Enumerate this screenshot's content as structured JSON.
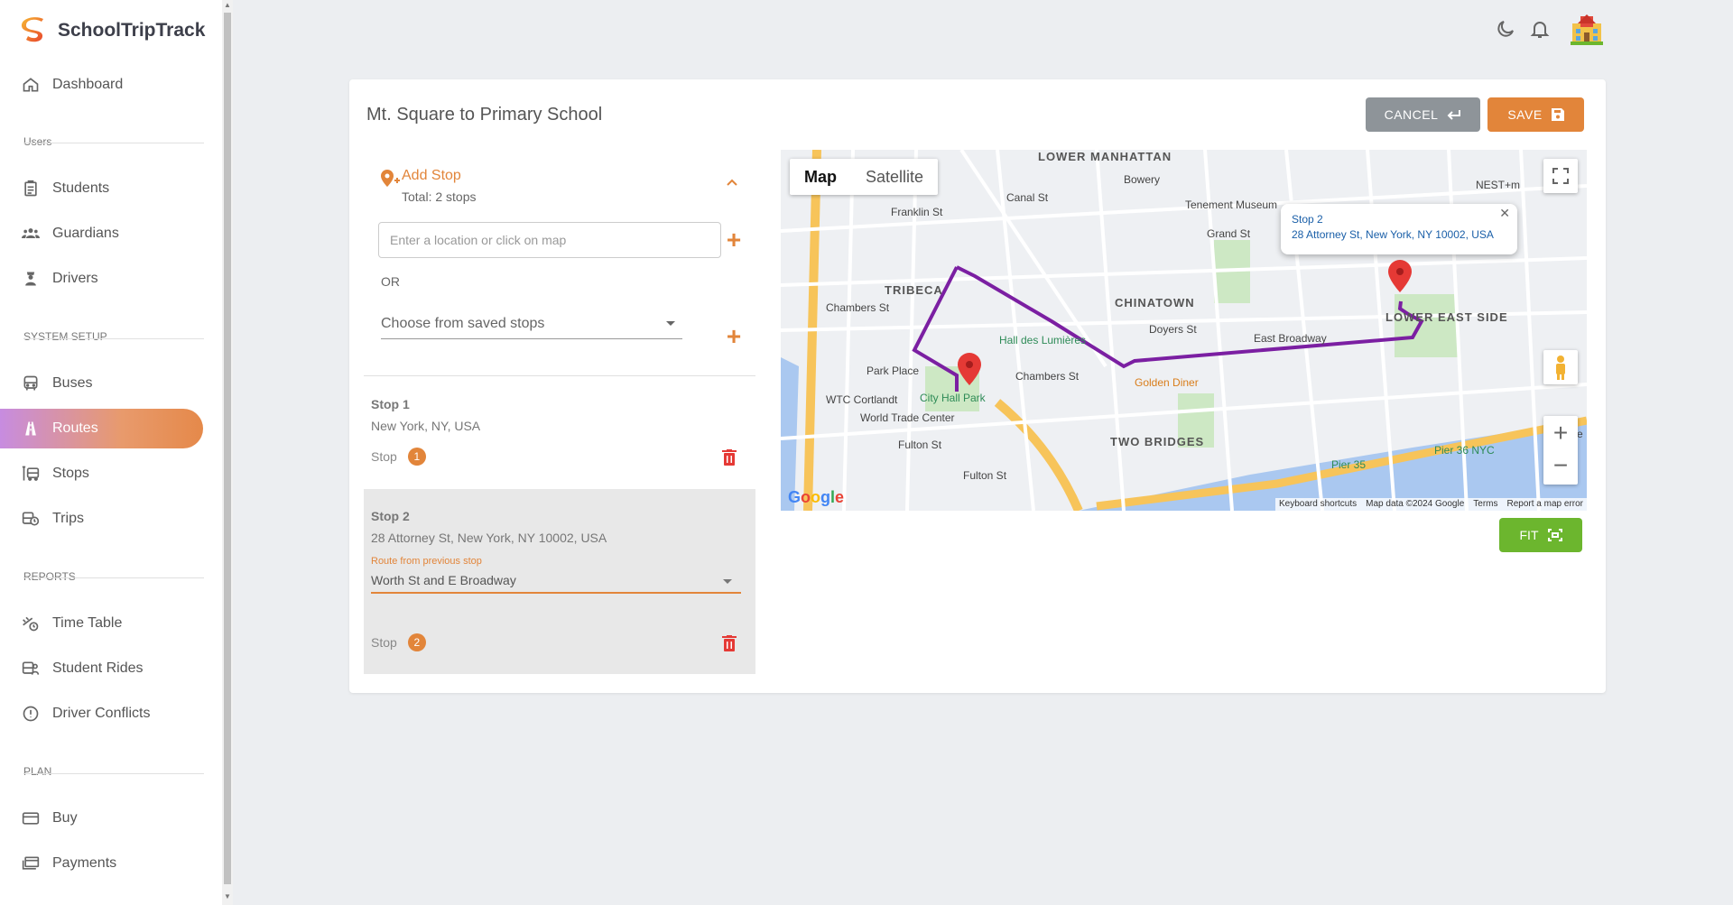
{
  "app": {
    "name": "SchoolTripTrack"
  },
  "sidebar": {
    "items": [
      {
        "label": "Dashboard",
        "icon": "home-icon"
      },
      {
        "label": "Students",
        "icon": "clipboard-icon"
      },
      {
        "label": "Guardians",
        "icon": "group-icon"
      },
      {
        "label": "Drivers",
        "icon": "driver-icon"
      },
      {
        "label": "Buses",
        "icon": "bus-icon"
      },
      {
        "label": "Routes",
        "icon": "road-icon"
      },
      {
        "label": "Stops",
        "icon": "bus-stop-icon"
      },
      {
        "label": "Trips",
        "icon": "bus-clock-icon"
      },
      {
        "label": "Time Table",
        "icon": "timetable-icon"
      },
      {
        "label": "Student Rides",
        "icon": "ride-icon"
      },
      {
        "label": "Driver Conflicts",
        "icon": "alert-circle-icon"
      },
      {
        "label": "Buy",
        "icon": "card-icon"
      },
      {
        "label": "Payments",
        "icon": "payments-icon"
      }
    ],
    "sections": {
      "users": "Users",
      "setup": "SYSTEM SETUP",
      "reports": "REPORTS",
      "plan": "PLAN"
    },
    "active": "Routes"
  },
  "page": {
    "title": "Mt. Square to Primary School",
    "cancel_label": "CANCEL",
    "save_label": "SAVE",
    "fit_label": "FIT"
  },
  "add_stop": {
    "title": "Add Stop",
    "total": "Total: 2 stops",
    "location_placeholder": "Enter a location or click on map",
    "or_text": "OR",
    "saved_stops_label": "Choose from saved stops"
  },
  "stops": [
    {
      "title": "Stop 1",
      "address": "New York, NY, USA",
      "label": "Stop",
      "number": "1"
    },
    {
      "title": "Stop 2",
      "address": "28 Attorney St, New York, NY 10002, USA",
      "route_label": "Route from previous stop",
      "route_value": "Worth St and E Broadway",
      "label": "Stop",
      "number": "2"
    }
  ],
  "map": {
    "type_map": "Map",
    "type_satellite": "Satellite",
    "info_title": "Stop 2",
    "info_address": "28 Attorney St, New York, NY 10002, USA",
    "footer": {
      "shortcuts": "Keyboard shortcuts",
      "data": "Map data ©2024 Google",
      "terms": "Terms",
      "report": "Report a map error"
    },
    "google": "Google",
    "labels": {
      "lower_manhattan": "LOWER MANHATTAN",
      "tribeca": "TRIBECA",
      "chinatown": "CHINATOWN",
      "lower_east_side": "LOWER EAST SIDE",
      "two_bridges": "TWO BRIDGES",
      "city_hall_park": "City Hall Park",
      "hall_des_lumieres": "Hall des Lumières",
      "golden_diner": "Golden Diner",
      "world_trade_center": "World Trade Center",
      "wtc_cortlandt": "WTC Cortlandt",
      "pier_35": "Pier 35",
      "pier_36": "Pier 36 NYC",
      "canal_st": "Canal St",
      "chambers_st": "Chambers St",
      "fulton_st": "Fulton St",
      "east_broadway": "East Broadway",
      "grand_st": "Grand St",
      "franklin_st": "Franklin St",
      "park_place": "Park Place",
      "doyers_st": "Doyers St",
      "tenement_museum": "Tenement Museum",
      "bowery": "Bowery",
      "nest": "NEST+m",
      "corlears": "Corle"
    }
  }
}
